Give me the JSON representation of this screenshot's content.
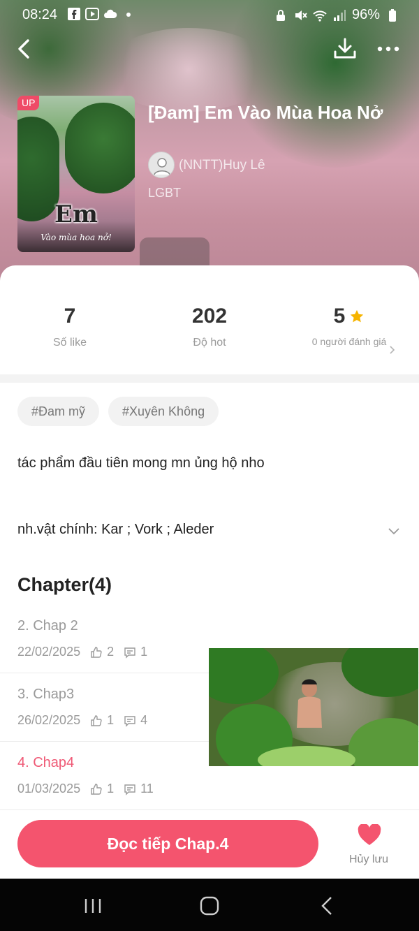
{
  "status_bar": {
    "time": "08:24",
    "battery": "96%",
    "icons": [
      "facebook-icon",
      "video-app-icon",
      "cloud-icon",
      "dot-icon",
      "lock-icon",
      "mute-icon",
      "wifi-icon",
      "signal-icon",
      "battery-icon"
    ]
  },
  "header": {
    "back_icon": "chevron-left-icon",
    "download_icon": "download-icon",
    "more_icon": "more-dots-icon"
  },
  "book": {
    "badge": "UP",
    "cover_title": "Em",
    "cover_subtitle": "Vào mùa hoa nở!",
    "title": "[Đam] Em Vào Mùa Hoa Nở",
    "author": "(NNTT)Huy Lê",
    "genre": "LGBT"
  },
  "stats": {
    "likes": {
      "value": "7",
      "label": "Số like"
    },
    "hot": {
      "value": "202",
      "label": "Độ hot"
    },
    "rating": {
      "value": "5",
      "label": "0 người đánh giá"
    }
  },
  "tags": [
    "#Đam mỹ",
    "#Xuyên Không"
  ],
  "description": "tác phẩm đầu tiên mong mn ủng hộ nho",
  "characters": "nh.vật chính: Kar ; Vork ; Aleder",
  "chapters": {
    "heading": "Chapter(4)",
    "items": [
      {
        "title": "2. Chap 2",
        "date": "22/02/2025",
        "likes": "2",
        "comments": "1"
      },
      {
        "title": "3. Chap3",
        "date": "26/02/2025",
        "likes": "1",
        "comments": "4"
      },
      {
        "title": "4. Chap4",
        "date": "01/03/2025",
        "likes": "1",
        "comments": "11"
      }
    ]
  },
  "actions": {
    "read_button": "Đọc tiếp Chap.4",
    "favorite_label": "Hủy lưu"
  },
  "colors": {
    "accent": "#f4546e",
    "active_chapter": "#ef5a76",
    "star": "#f6b400"
  }
}
